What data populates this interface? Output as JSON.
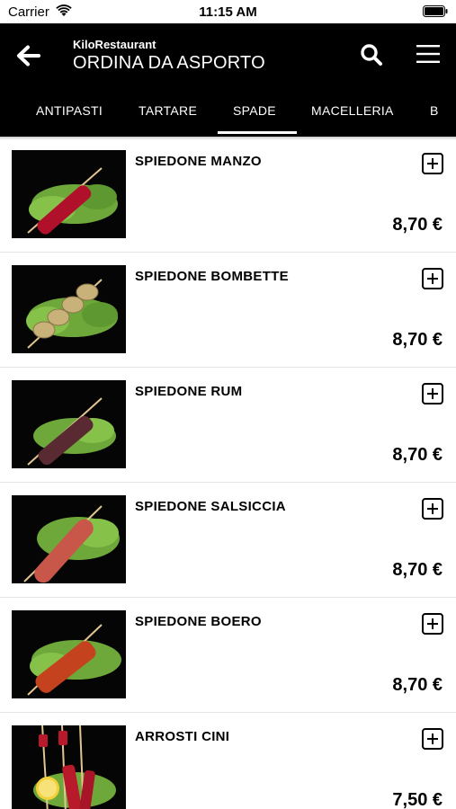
{
  "status_bar": {
    "carrier": "Carrier",
    "time": "11:15 AM"
  },
  "header": {
    "subtitle": "KiloRestaurant",
    "title": "ORDINA DA ASPORTO"
  },
  "tabs": [
    {
      "label": "ANTIPASTI"
    },
    {
      "label": "TARTARE"
    },
    {
      "label": "SPADE",
      "active": true
    },
    {
      "label": "MACELLERIA"
    },
    {
      "label": "B"
    }
  ],
  "items": [
    {
      "name": "SPIEDONE MANZO",
      "price": "8,70 €",
      "meat_color": "#b0102a"
    },
    {
      "name": "SPIEDONE BOMBETTE",
      "price": "8,70 €",
      "meat_color": "#c9b27a"
    },
    {
      "name": "SPIEDONE RUM",
      "price": "8,70 €",
      "meat_color": "#5a2a33"
    },
    {
      "name": "SPIEDONE SALSICCIA",
      "price": "8,70 €",
      "meat_color": "#c8574a"
    },
    {
      "name": "SPIEDONE BOERO",
      "price": "8,70 €",
      "meat_color": "#c5421e"
    },
    {
      "name": "ARROSTI CINI",
      "price": "7,50 €",
      "meat_color": "#b81a2c"
    }
  ],
  "colors": {
    "header_bg": "#000000",
    "lettuce": "#6fa83a"
  }
}
